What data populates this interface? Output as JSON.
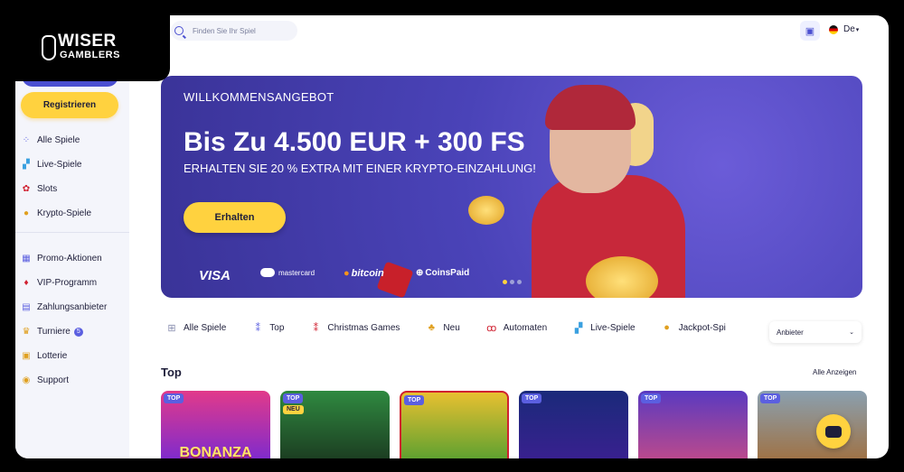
{
  "logo": {
    "line1": "WISER",
    "line2": "GAMBLERS"
  },
  "search": {
    "placeholder": "Finden Sie Ihr Spiel"
  },
  "header": {
    "language": "De"
  },
  "sidebar": {
    "register_label": "Registrieren",
    "group1": [
      {
        "label": "Alle Spiele",
        "icon": "grid-icon"
      },
      {
        "label": "Live-Spiele",
        "icon": "live-icon"
      },
      {
        "label": "Slots",
        "icon": "slots-icon"
      },
      {
        "label": "Krypto-Spiele",
        "icon": "crypto-icon"
      }
    ],
    "group2": [
      {
        "label": "Promo-Aktionen",
        "icon": "promo-icon"
      },
      {
        "label": "VIP-Programm",
        "icon": "vip-icon"
      },
      {
        "label": "Zahlungsanbieter",
        "icon": "payment-icon"
      },
      {
        "label": "Turniere",
        "icon": "trophy-icon",
        "badge": "5"
      },
      {
        "label": "Lotterie",
        "icon": "lottery-icon"
      },
      {
        "label": "Support",
        "icon": "support-icon"
      }
    ]
  },
  "banner": {
    "welcome": "WILLKOMMENSANGEBOT",
    "headline": "Bis Zu 4.500 EUR + 300 FS",
    "subline": "ERHALTEN SIE 20 % EXTRA MIT EINER KRYPTO-EINZAHLUNG!",
    "cta": "Erhalten",
    "payments": [
      "VISA",
      "mastercard",
      "bitcoin",
      "CoinsPaid"
    ]
  },
  "tabs": [
    {
      "label": "Alle Spiele",
      "icon": "grid-icon"
    },
    {
      "label": "Top",
      "icon": "top-icon"
    },
    {
      "label": "Christmas Games",
      "icon": "christmas-icon"
    },
    {
      "label": "Neu",
      "icon": "clover-icon"
    },
    {
      "label": "Automaten",
      "icon": "cherry-icon"
    },
    {
      "label": "Live-Spiele",
      "icon": "live-icon"
    },
    {
      "label": "Jackpot-Spi",
      "icon": "jackpot-icon"
    }
  ],
  "provider_select": {
    "value": "Anbieter"
  },
  "top_section": {
    "title": "Top",
    "see_all": "Alle Anzeigen",
    "games": [
      {
        "tag": "TOP",
        "tag2": "",
        "title": "BONANZA"
      },
      {
        "tag": "TOP",
        "tag2": "NEU",
        "title": ""
      },
      {
        "tag": "TOP",
        "tag2": "",
        "title": ""
      },
      {
        "tag": "TOP",
        "tag2": "",
        "title": ""
      },
      {
        "tag": "TOP",
        "tag2": "",
        "title": ""
      },
      {
        "tag": "TOP",
        "tag2": "",
        "title": ""
      }
    ]
  }
}
